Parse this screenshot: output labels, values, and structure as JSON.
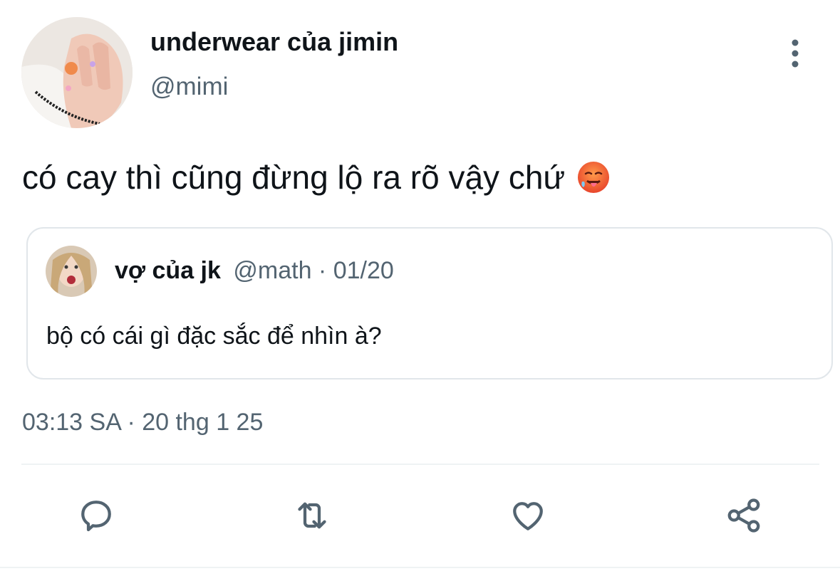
{
  "tweet": {
    "author_name": "underwear của jimin",
    "author_handle": "@mimi",
    "text": "có cay thì cũng đừng lộ ra rõ vậy chứ",
    "emoji": "hot-face",
    "timestamp": "03:13 SA · 20 thg 1 25"
  },
  "quoted_tweet": {
    "author_name": "vợ của jk",
    "meta": "@math · 01/20",
    "text": "bộ có cái gì đặc sắc để nhìn à?"
  },
  "actions": {
    "icons": [
      "reply-icon",
      "retweet-icon",
      "like-icon",
      "share-icon"
    ]
  },
  "colors": {
    "primary_text": "#0f1419",
    "secondary_text": "#536471",
    "border": "#e1e6ea",
    "icon": "#536471"
  }
}
